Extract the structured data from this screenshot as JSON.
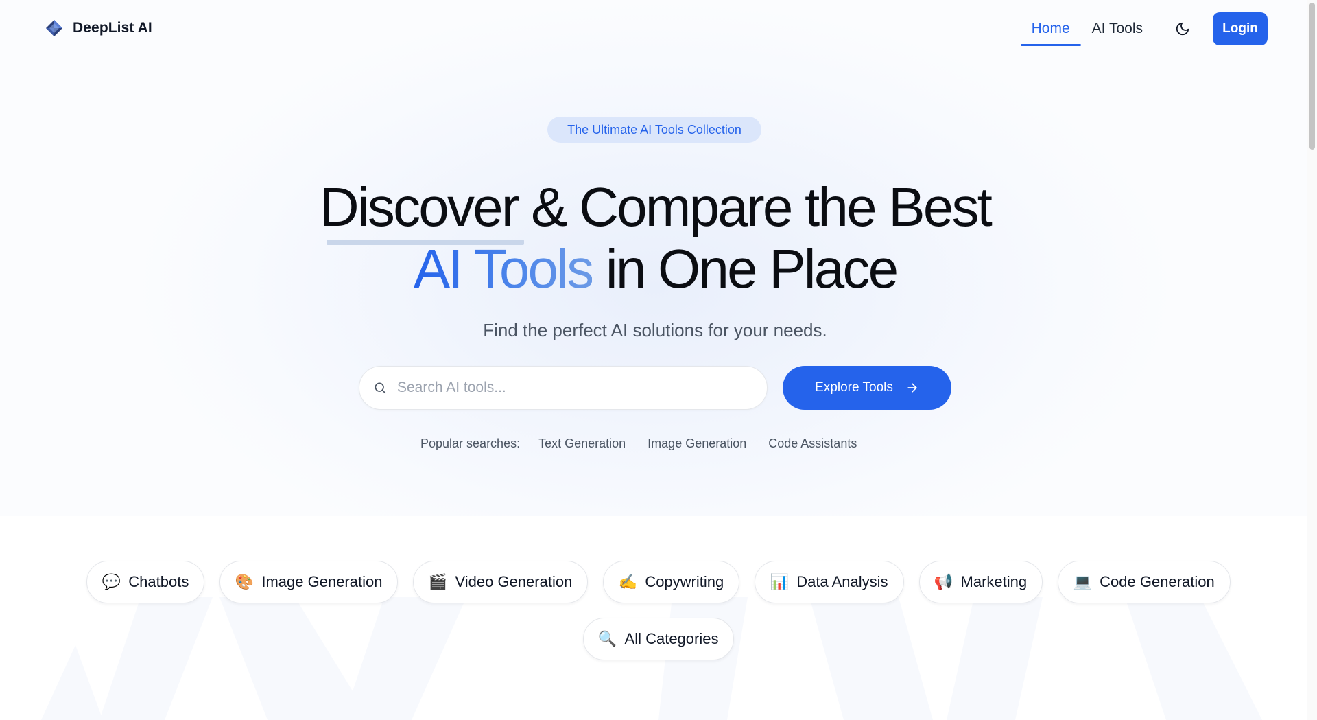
{
  "header": {
    "logo_text": "DeepList AI",
    "nav": [
      {
        "label": "Home",
        "active": true
      },
      {
        "label": "AI Tools",
        "active": false
      }
    ],
    "theme_icon": "moon-icon",
    "login_label": "Login"
  },
  "hero": {
    "badge": "The Ultimate AI Tools Collection",
    "title_line1": "Discover & Compare the Best",
    "title_accent": "AI Tools",
    "title_line2_rest": "in One Place",
    "subtitle": "Find the perfect AI solutions for your needs.",
    "search_placeholder": "Search AI tools...",
    "search_value": "",
    "explore_label": "Explore Tools",
    "popular_label": "Popular searches:",
    "popular_searches": [
      "Text Generation",
      "Image Generation",
      "Code Assistants"
    ]
  },
  "categories": [
    {
      "icon": "💬",
      "label": "Chatbots"
    },
    {
      "icon": "🎨",
      "label": "Image Generation"
    },
    {
      "icon": "🎬",
      "label": "Video Generation"
    },
    {
      "icon": "✍️",
      "label": "Copywriting"
    },
    {
      "icon": "📊",
      "label": "Data Analysis"
    },
    {
      "icon": "📢",
      "label": "Marketing"
    },
    {
      "icon": "💻",
      "label": "Code Generation"
    },
    {
      "icon": "🔍",
      "label": "All Categories"
    }
  ],
  "colors": {
    "accent": "#2563eb",
    "badge_bg": "#dbe6fb",
    "text": "#111827"
  }
}
